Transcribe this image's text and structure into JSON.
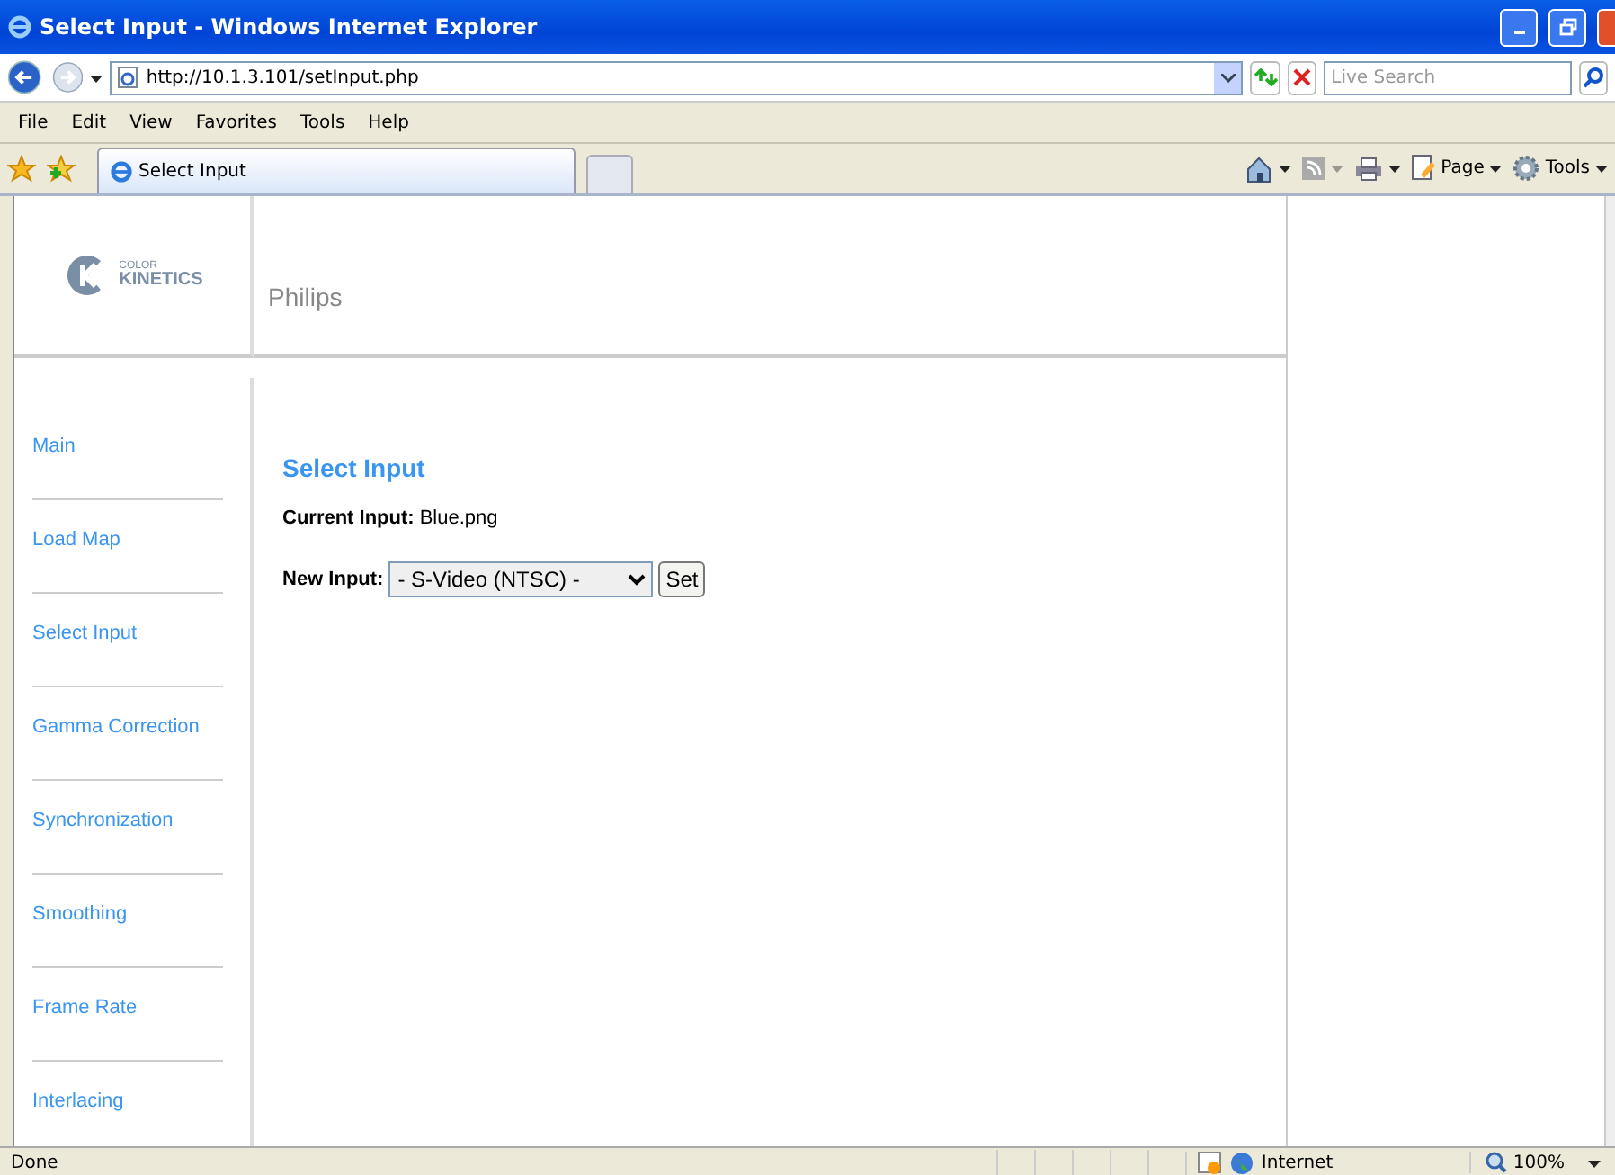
{
  "window": {
    "title": "Select Input - Windows Internet Explorer"
  },
  "address_bar": {
    "url": "http://10.1.3.101/setInput.php",
    "search_placeholder": "Live Search"
  },
  "menu": [
    "File",
    "Edit",
    "View",
    "Favorites",
    "Tools",
    "Help"
  ],
  "tabs": [
    {
      "label": "Select Input",
      "selected": true
    }
  ],
  "command_bar": {
    "page": "Page",
    "tools": "Tools"
  },
  "header": {
    "logo_small": "COLOR",
    "logo_big": "KINETICS",
    "brand": "Philips"
  },
  "sidebar": {
    "items": [
      "Main",
      "Load Map",
      "Select Input",
      "Gamma Correction",
      "Synchronization",
      "Smoothing",
      "Frame Rate",
      "Interlacing"
    ]
  },
  "content": {
    "heading": "Select Input",
    "current_label": "Current Input:",
    "current_value": "Blue.png",
    "new_label": "New Input:",
    "new_value": "- S-Video (NTSC) -",
    "set_button": "Set"
  },
  "status_bar": {
    "text": "Done",
    "zone": "Internet",
    "zoom": "100%"
  }
}
